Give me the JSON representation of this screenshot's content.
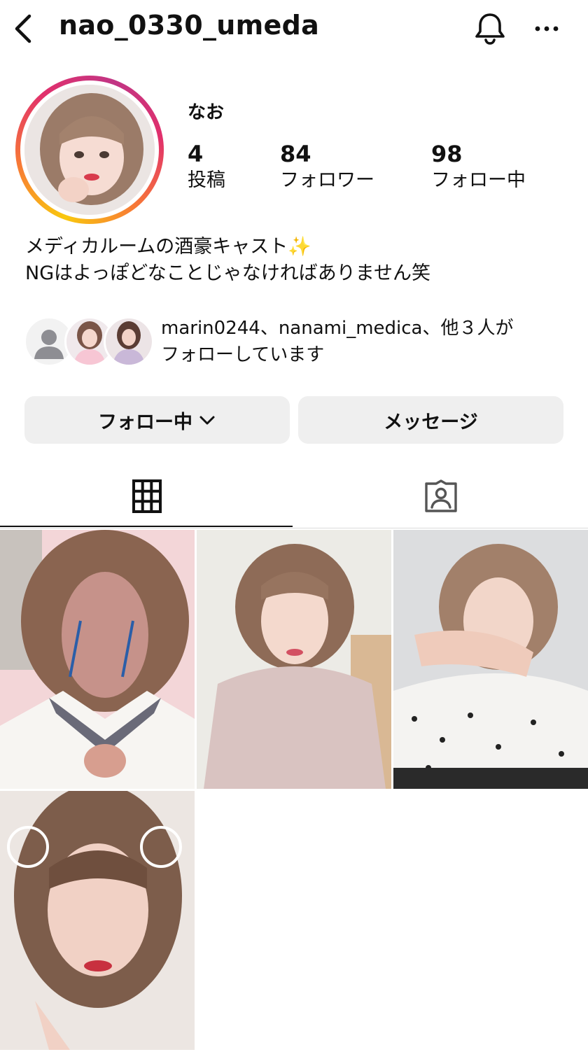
{
  "header": {
    "username": "nao_0330_umeda",
    "back_icon": "chevron-left-icon",
    "notify_icon": "bell-icon",
    "more_icon": "ellipsis-icon"
  },
  "profile": {
    "display_name": "なお",
    "stats": [
      {
        "value": "4",
        "label": "投稿"
      },
      {
        "value": "84",
        "label": "フォロワー"
      },
      {
        "value": "98",
        "label": "フォロー中"
      }
    ],
    "bio_lines": [
      "メディカルームの酒豪キャスト✨",
      "NGはよっぽどなことじゃなければありません笑"
    ]
  },
  "followed_by": {
    "line1": "marin0244、nanami_medica、他３人が",
    "line2": "フォローしています"
  },
  "actions": {
    "following_label": "フォロー中",
    "message_label": "メッセージ"
  },
  "tabs": [
    {
      "icon": "grid-icon",
      "active": true
    },
    {
      "icon": "tagged-person-icon",
      "active": false
    }
  ],
  "colors": {
    "button_bg": "#efefef",
    "story_ring": [
      "#f9c80e",
      "#f77737",
      "#e1306c",
      "#c13584"
    ]
  }
}
